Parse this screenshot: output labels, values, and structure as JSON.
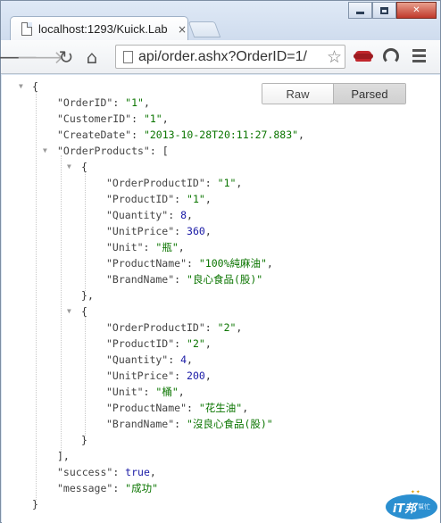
{
  "window": {
    "tab_title": "localhost:1293/Kuick.Lab",
    "tab_close": "×",
    "minimize_label": "",
    "maximize_label": "",
    "close_label": "✕"
  },
  "toolbar": {
    "back_glyph": "🡐",
    "forward_glyph": "🡒",
    "reload_glyph": "↻",
    "home_glyph": "⌂",
    "url": "/api/order.ashx?OrderID=1",
    "star_glyph": "☆",
    "icons": [
      "back-icon",
      "forward-icon",
      "reload-icon",
      "home-icon",
      "star-icon",
      "sofa-extension-icon",
      "circle-extension-icon",
      "menu-icon"
    ]
  },
  "viewer": {
    "raw_label": "Raw",
    "parsed_label": "Parsed",
    "open_brace": "{",
    "close_brace": "}",
    "open_bracket": "[",
    "close_bracket": "],",
    "order": {
      "OrderID": "\"1\"",
      "CustomerID": "\"1\"",
      "CreateDate": "\"2013-10-28T20:11:27.883\""
    },
    "products": [
      {
        "OrderProductID": "\"1\"",
        "ProductID": "\"1\"",
        "Quantity": "8",
        "UnitPrice": "360",
        "Unit": "\"瓶\"",
        "ProductName": "\"100%純麻油\"",
        "BrandName": "\"良心食品(股)\""
      },
      {
        "OrderProductID": "\"2\"",
        "ProductID": "\"2\"",
        "Quantity": "4",
        "UnitPrice": "200",
        "Unit": "\"桶\"",
        "ProductName": "\"花生油\"",
        "BrandName": "\"沒良心食品(股)\""
      }
    ],
    "success": "true",
    "message": "\"成功\""
  },
  "watermark": {
    "text": "iT邦",
    "sub": "幫忙"
  }
}
